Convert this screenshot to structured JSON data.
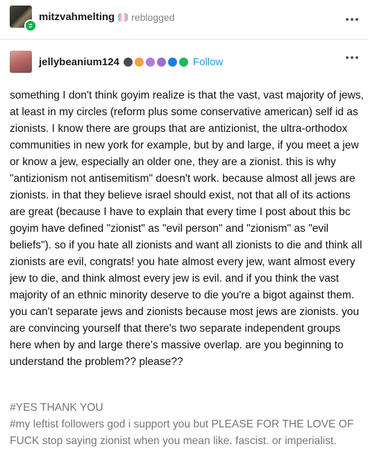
{
  "reblog": {
    "username": "mitzvahmelting",
    "action": "reblogged"
  },
  "post": {
    "username": "jellybeanium124",
    "follow_label": "Follow",
    "body": "something I don't think goyim realize is that the vast, vast majority of jews, at least in my circles (reform plus some conservative american) self id as zionists. I know there are groups that are antizionist, the ultra-orthodox communities in new york for example, but by and large, if you meet a jew or know a jew, especially an older one, they are a zionist. this is why \"antizionism not antisemitism\" doesn't work. because almost all jews are zionists. in that they believe israel should exist, not that all of its actions are great (because I have to explain that every time I post about this bc goyim have defined \"zionist\" as \"evil person\" and \"zionism\" as \"evil beliefs\"). so if you hate all zionists and want all zionists to die and think all zionists are evil, congrats! you hate almost every jew, want almost every jew to die, and think almost every jew is evil. and if you think the vast majority of an ethnic minority deserve to die you're a bigot against them. you can't separate jews and zionists because most jews are zionists. you are convincing yourself that there's two separate independent groups here when by and large there's massive overlap. are you beginning to understand the problem?? please??",
    "tags": [
      "#YES THANK YOU",
      "#my leftist followers god i support you but PLEASE FOR THE LOVE OF FUCK stop saying zionist when you mean like. fascist. or imperialist."
    ]
  },
  "icons": {
    "reblog_badge": "reblog-icon",
    "more": "more-options-icon",
    "badges": [
      "pride-badge-icon",
      "dark-badge-icon",
      "paw-badge-icon",
      "purple-face-badge-icon",
      "purple-gear-badge-icon",
      "blue-check-badge-icon",
      "green-check-badge-icon"
    ]
  },
  "colors": {
    "follow": "#1f9dd6",
    "tags": "#767676",
    "reblog_badge": "#00b24a"
  }
}
